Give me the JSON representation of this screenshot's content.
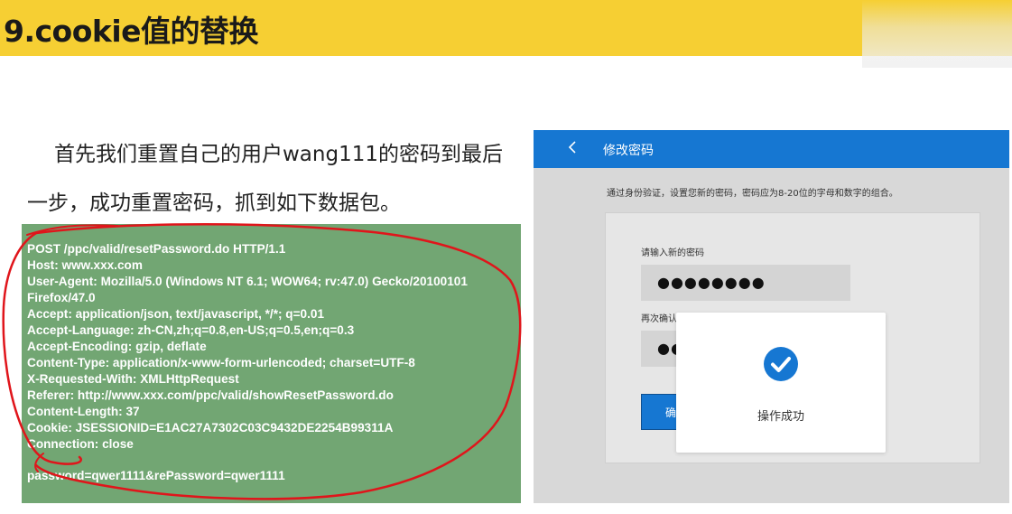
{
  "header": {
    "title": "9.cookie值的替换"
  },
  "intro": {
    "line1": "首先我们重置自己的用户wang111的密码到最后",
    "line2": "一步，成功重置密码，抓到如下数据包。"
  },
  "request": {
    "lines": [
      "POST /ppc/valid/resetPassword.do HTTP/1.1",
      "Host: www.xxx.com",
      "User-Agent: Mozilla/5.0 (Windows NT 6.1; WOW64; rv:47.0) Gecko/20100101",
      "Firefox/47.0",
      "Accept: application/json, text/javascript, */*; q=0.01",
      "Accept-Language: zh-CN,zh;q=0.8,en-US;q=0.5,en;q=0.3",
      "Accept-Encoding: gzip, deflate",
      "Content-Type: application/x-www-form-urlencoded; charset=UTF-8",
      "X-Requested-With: XMLHttpRequest",
      "Referer: http://www.xxx.com/ppc/valid/showResetPassword.do",
      "Content-Length: 37",
      "Cookie: JSESSIONID=E1AC27A7302C03C9432DE2254B99311A",
      "Connection: close"
    ],
    "body": "password=qwer1111&rePassword=qwer1111"
  },
  "app": {
    "back_icon": "chevron-left-icon",
    "title": "修改密码",
    "hint": "通过身份验证，设置您新的密码，密码应为8-20位的字母和数字的组合。",
    "new_password_label": "请输入新的密码",
    "new_password_value": "●●●●●●●●",
    "confirm_label": "再次确认密码",
    "confirm_value": "●●",
    "confirm_button": "确",
    "toast_text": "操作成功",
    "toast_icon": "check-circle-icon",
    "accent": "#1677d2"
  },
  "colors": {
    "header": "#f6cf33",
    "request_bg": "#72a673",
    "scribble": "#e0151b"
  }
}
